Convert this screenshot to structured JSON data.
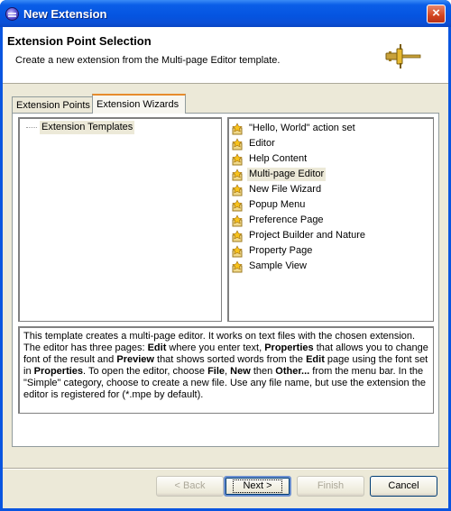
{
  "window": {
    "title": "New Extension",
    "close_glyph": "×"
  },
  "header": {
    "title": "Extension Point Selection",
    "description": "Create a new extension from the Multi-page Editor template.",
    "icon": "plug-icon"
  },
  "tabs": [
    {
      "label": "Extension Points",
      "selected": false
    },
    {
      "label": "Extension Wizards",
      "selected": true
    }
  ],
  "left_tree": {
    "items": [
      {
        "label": "Extension Templates",
        "selected": true
      }
    ]
  },
  "wizards": {
    "icon": "wizard-template-icon",
    "items": [
      {
        "label": "\"Hello, World\" action set",
        "selected": false
      },
      {
        "label": "Editor",
        "selected": false
      },
      {
        "label": "Help Content",
        "selected": false
      },
      {
        "label": "Multi-page Editor",
        "selected": true
      },
      {
        "label": "New File Wizard",
        "selected": false
      },
      {
        "label": "Popup Menu",
        "selected": false
      },
      {
        "label": "Preference Page",
        "selected": false
      },
      {
        "label": "Project Builder and Nature",
        "selected": false
      },
      {
        "label": "Property Page",
        "selected": false
      },
      {
        "label": "Sample View",
        "selected": false
      }
    ]
  },
  "description": {
    "segments": [
      {
        "text": "This template creates a multi-page editor. It works on text files with the chosen extension. The editor has three pages: ",
        "bold": false
      },
      {
        "text": "Edit",
        "bold": true
      },
      {
        "text": " where you enter text, ",
        "bold": false
      },
      {
        "text": "Properties",
        "bold": true
      },
      {
        "text": " that allows you to change font of the result and ",
        "bold": false
      },
      {
        "text": "Preview",
        "bold": true
      },
      {
        "text": " that shows sorted words from the ",
        "bold": false
      },
      {
        "text": "Edit",
        "bold": true
      },
      {
        "text": " page using the font set in ",
        "bold": false
      },
      {
        "text": "Properties",
        "bold": true
      },
      {
        "text": ". To open the editor, choose ",
        "bold": false
      },
      {
        "text": "File",
        "bold": true
      },
      {
        "text": ", ",
        "bold": false
      },
      {
        "text": "New",
        "bold": true
      },
      {
        "text": " then ",
        "bold": false
      },
      {
        "text": "Other...",
        "bold": true
      },
      {
        "text": " from the menu bar. In the \"Simple\" category, choose to create a new file. Use any file name, but use the extension the editor is registered for (*.mpe by default).",
        "bold": false
      }
    ]
  },
  "buttons": {
    "back": {
      "label": "< Back",
      "enabled": false
    },
    "next": {
      "label": "Next >",
      "enabled": true
    },
    "finish": {
      "label": "Finish",
      "enabled": false
    },
    "cancel": {
      "label": "Cancel",
      "enabled": true
    }
  },
  "colors": {
    "titlebar": "#0554e0",
    "dialog_bg": "#ece9d8",
    "selection_bg": "#ece9d8",
    "active_tab_accent": "#e68b2c"
  }
}
